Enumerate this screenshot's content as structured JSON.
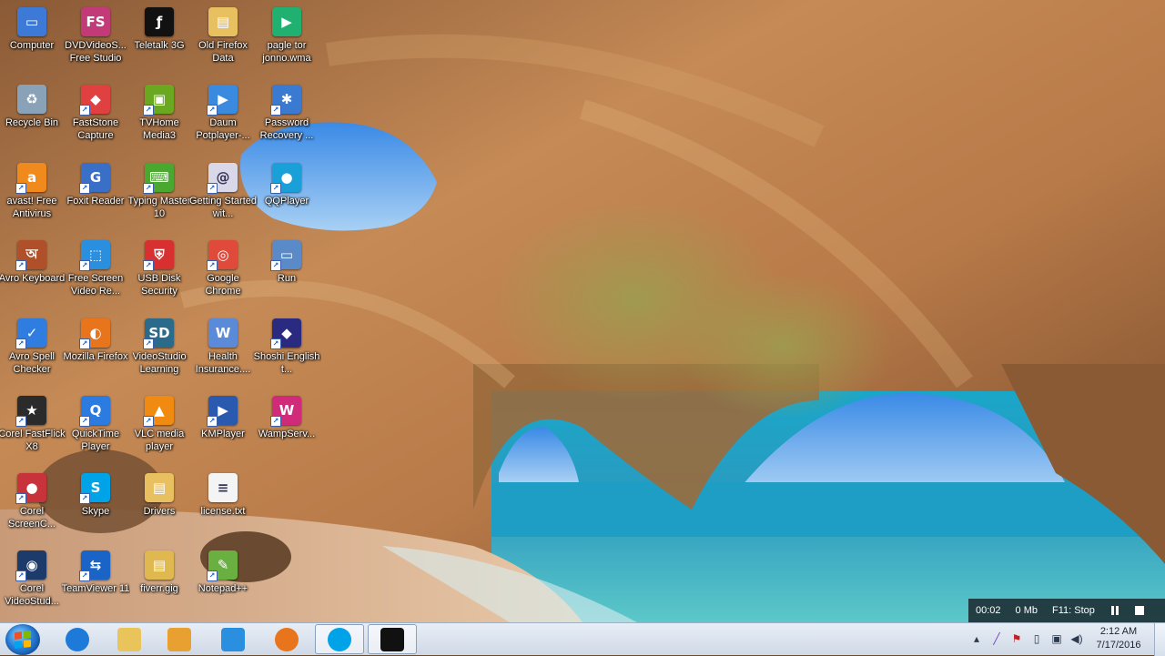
{
  "desktop": {
    "icons": [
      {
        "label": "Computer",
        "icon": "computer-icon",
        "color": "#3d7ad8",
        "glyph": "▭",
        "shortcut": false
      },
      {
        "label": "Recycle Bin",
        "icon": "recycle-bin-icon",
        "color": "#8aa2b8",
        "glyph": "♻",
        "shortcut": false
      },
      {
        "label": "avast! Free Antivirus",
        "icon": "avast-icon",
        "color": "#f08a1c",
        "glyph": "a",
        "shortcut": true
      },
      {
        "label": "Avro Keyboard",
        "icon": "avro-keyboard-icon",
        "color": "#b0502a",
        "glyph": "অ",
        "shortcut": true
      },
      {
        "label": "Avro Spell Checker",
        "icon": "avro-spell-checker-icon",
        "color": "#2f7de0",
        "glyph": "✓",
        "shortcut": true
      },
      {
        "label": "Corel FastFlick X8",
        "icon": "corel-fastflick-icon",
        "color": "#2b2b2b",
        "glyph": "★",
        "shortcut": true
      },
      {
        "label": "Corel ScreenC...",
        "icon": "corel-screencap-icon",
        "color": "#c8323a",
        "glyph": "●",
        "shortcut": true
      },
      {
        "label": "Corel VideoStud...",
        "icon": "corel-videostudio-icon",
        "color": "#1c3a6a",
        "glyph": "◉",
        "shortcut": true
      },
      {
        "label": "DVDVideoS... Free Studio",
        "icon": "dvdvideosoft-icon",
        "color": "#c23a78",
        "glyph": "FS",
        "shortcut": false
      },
      {
        "label": "FastStone Capture",
        "icon": "faststone-capture-icon",
        "color": "#e04040",
        "glyph": "◆",
        "shortcut": true
      },
      {
        "label": "Foxit Reader",
        "icon": "foxit-reader-icon",
        "color": "#3a6fc8",
        "glyph": "G",
        "shortcut": true
      },
      {
        "label": "Free Screen Video Re...",
        "icon": "free-screen-video-recorder-icon",
        "color": "#2b8fe0",
        "glyph": "⬚",
        "shortcut": true
      },
      {
        "label": "Mozilla Firefox",
        "icon": "firefox-icon",
        "color": "#e8741c",
        "glyph": "◐",
        "shortcut": true
      },
      {
        "label": "QuickTime Player",
        "icon": "quicktime-icon",
        "color": "#2c7be0",
        "glyph": "Q",
        "shortcut": true
      },
      {
        "label": "Skype",
        "icon": "skype-icon",
        "color": "#00a3e8",
        "glyph": "S",
        "shortcut": true
      },
      {
        "label": "TeamViewer 11",
        "icon": "teamviewer-icon",
        "color": "#1a64c8",
        "glyph": "⇆",
        "shortcut": true
      },
      {
        "label": "Teletalk 3G",
        "icon": "teletalk-icon",
        "color": "#111111",
        "glyph": "ƒ",
        "shortcut": false
      },
      {
        "label": "TVHome Media3",
        "icon": "tvhome-icon",
        "color": "#6aa820",
        "glyph": "▣",
        "shortcut": true
      },
      {
        "label": "Typing Master 10",
        "icon": "typing-master-icon",
        "color": "#4aa830",
        "glyph": "⌨",
        "shortcut": true
      },
      {
        "label": "USB Disk Security",
        "icon": "usb-disk-security-icon",
        "color": "#d83030",
        "glyph": "⛨",
        "shortcut": true
      },
      {
        "label": "VideoStudio Learning",
        "icon": "videostudio-learning-icon",
        "color": "#2a6a8a",
        "glyph": "SD",
        "shortcut": true
      },
      {
        "label": "VLC media player",
        "icon": "vlc-icon",
        "color": "#f08a10",
        "glyph": "▲",
        "shortcut": true
      },
      {
        "label": "Drivers",
        "icon": "folder-icon",
        "color": "#e8c060",
        "glyph": "▤",
        "shortcut": false
      },
      {
        "label": "fiverr.gig",
        "icon": "fiverr-gig-file-icon",
        "color": "#e0b850",
        "glyph": "▤",
        "shortcut": false
      },
      {
        "label": "Old Firefox Data",
        "icon": "folder-icon",
        "color": "#e8c060",
        "glyph": "▤",
        "shortcut": false
      },
      {
        "label": "Daum Potplayer-...",
        "icon": "potplayer-icon",
        "color": "#3a8ae0",
        "glyph": "▶",
        "shortcut": true
      },
      {
        "label": "Getting Started wit...",
        "icon": "getting-started-icon",
        "color": "#d8d8e8",
        "glyph": "@",
        "shortcut": true
      },
      {
        "label": "Google Chrome",
        "icon": "chrome-icon",
        "color": "#e04a3a",
        "glyph": "◎",
        "shortcut": true
      },
      {
        "label": "Health Insurance....",
        "icon": "word-document-icon",
        "color": "#5a8ad8",
        "glyph": "W",
        "shortcut": false
      },
      {
        "label": "KMPlayer",
        "icon": "kmplayer-icon",
        "color": "#2a5ab0",
        "glyph": "▶",
        "shortcut": true
      },
      {
        "label": "license.txt",
        "icon": "text-file-icon",
        "color": "#f4f4f4",
        "glyph": "≡",
        "shortcut": false
      },
      {
        "label": "Notepad++",
        "icon": "notepad-plus-plus-icon",
        "color": "#6ab040",
        "glyph": "✎",
        "shortcut": true
      },
      {
        "label": "pagle tor jonno.wma",
        "icon": "wma-file-icon",
        "color": "#20b070",
        "glyph": "▶",
        "shortcut": false
      },
      {
        "label": "Password Recovery ...",
        "icon": "password-recovery-icon",
        "color": "#3a7ad0",
        "glyph": "✱",
        "shortcut": true
      },
      {
        "label": "QQPlayer",
        "icon": "qqplayer-icon",
        "color": "#1aa0d8",
        "glyph": "●",
        "shortcut": true
      },
      {
        "label": "Run",
        "icon": "run-icon",
        "color": "#5a8ac8",
        "glyph": "▭",
        "shortcut": true
      },
      {
        "label": "Shoshi English t...",
        "icon": "shoshi-english-icon",
        "color": "#2a2a80",
        "glyph": "◆",
        "shortcut": true
      },
      {
        "label": "WampServ...",
        "icon": "wampserver-icon",
        "color": "#d02a7a",
        "glyph": "W",
        "shortcut": true
      }
    ]
  },
  "recorder": {
    "time": "00:02",
    "size": "0 Mb",
    "stop_hint": "F11: Stop"
  },
  "taskbar": {
    "pinned": [
      {
        "icon": "internet-explorer-icon",
        "color": "#1e7ad8",
        "active": false
      },
      {
        "icon": "file-explorer-icon",
        "color": "#e8c45a",
        "active": false
      },
      {
        "icon": "media-player-icon",
        "color": "#e8a030",
        "active": false
      },
      {
        "icon": "screen-capture-icon",
        "color": "#2b8fe0",
        "active": false
      },
      {
        "icon": "firefox-icon",
        "color": "#e8741c",
        "active": false
      },
      {
        "icon": "skype-icon",
        "color": "#00a3e8",
        "active": true
      },
      {
        "icon": "flash-recorder-icon",
        "color": "#111111",
        "active": true
      }
    ]
  },
  "tray": {
    "time": "2:12 AM",
    "date": "7/17/2016"
  }
}
